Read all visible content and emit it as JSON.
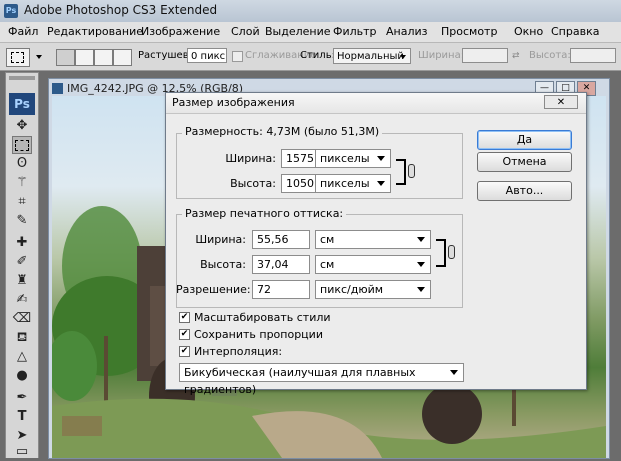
{
  "app": {
    "title": "Adobe Photoshop CS3 Extended",
    "logo": "Ps"
  },
  "menu": [
    "Файл",
    "Редактирование",
    "Изображение",
    "Слой",
    "Выделение",
    "Фильтр",
    "Анализ",
    "Просмотр",
    "Окно",
    "Справка"
  ],
  "options": {
    "feather_label": "Растушевка:",
    "feather_value": "0 пикс",
    "antialias_label": "Сглаживание",
    "style_label": "Стиль:",
    "style_value": "Нормальный",
    "width_label": "Ширина:",
    "height_label": "Высота:"
  },
  "document": {
    "title": "IMG_4242.JPG @ 12,5% (RGB/8)"
  },
  "dialog": {
    "title": "Размер изображения",
    "close": "✕",
    "pixel_dim_label": "Размерность:",
    "pixel_dim_value": "4,73M (было 51,3M)",
    "px_width_label": "Ширина:",
    "px_width_value": "1575",
    "px_width_unit": "пикселы",
    "px_height_label": "Высота:",
    "px_height_value": "1050",
    "px_height_unit": "пикселы",
    "doc_size_label": "Размер печатного оттиска:",
    "doc_width_label": "Ширина:",
    "doc_width_value": "55,56",
    "doc_width_unit": "см",
    "doc_height_label": "Высота:",
    "doc_height_value": "37,04",
    "doc_height_unit": "см",
    "resolution_label": "Разрешение:",
    "resolution_value": "72",
    "resolution_unit": "пикс/дюйм",
    "scale_styles": "Масштабировать стили",
    "constrain": "Сохранить пропорции",
    "resample": "Интерполяция:",
    "resample_method": "Бикубическая (наилучшая для плавных градиентов)",
    "ok": "Да",
    "cancel": "Отмена",
    "auto": "Авто..."
  }
}
